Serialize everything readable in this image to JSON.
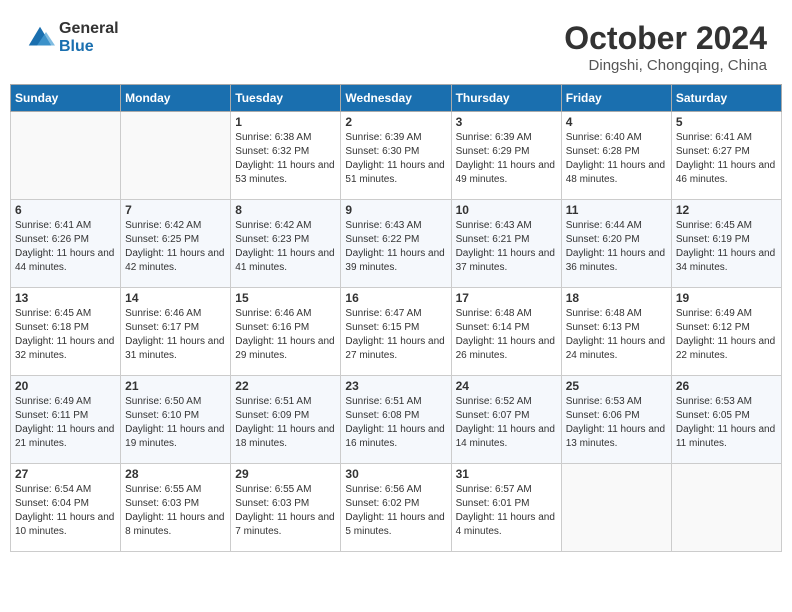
{
  "header": {
    "logo": {
      "general": "General",
      "blue": "Blue"
    },
    "title": "October 2024",
    "location": "Dingshi, Chongqing, China"
  },
  "weekdays": [
    "Sunday",
    "Monday",
    "Tuesday",
    "Wednesday",
    "Thursday",
    "Friday",
    "Saturday"
  ],
  "weeks": [
    [
      {
        "day": "",
        "info": ""
      },
      {
        "day": "",
        "info": ""
      },
      {
        "day": "1",
        "info": "Sunrise: 6:38 AM\nSunset: 6:32 PM\nDaylight: 11 hours and 53 minutes."
      },
      {
        "day": "2",
        "info": "Sunrise: 6:39 AM\nSunset: 6:30 PM\nDaylight: 11 hours and 51 minutes."
      },
      {
        "day": "3",
        "info": "Sunrise: 6:39 AM\nSunset: 6:29 PM\nDaylight: 11 hours and 49 minutes."
      },
      {
        "day": "4",
        "info": "Sunrise: 6:40 AM\nSunset: 6:28 PM\nDaylight: 11 hours and 48 minutes."
      },
      {
        "day": "5",
        "info": "Sunrise: 6:41 AM\nSunset: 6:27 PM\nDaylight: 11 hours and 46 minutes."
      }
    ],
    [
      {
        "day": "6",
        "info": "Sunrise: 6:41 AM\nSunset: 6:26 PM\nDaylight: 11 hours and 44 minutes."
      },
      {
        "day": "7",
        "info": "Sunrise: 6:42 AM\nSunset: 6:25 PM\nDaylight: 11 hours and 42 minutes."
      },
      {
        "day": "8",
        "info": "Sunrise: 6:42 AM\nSunset: 6:23 PM\nDaylight: 11 hours and 41 minutes."
      },
      {
        "day": "9",
        "info": "Sunrise: 6:43 AM\nSunset: 6:22 PM\nDaylight: 11 hours and 39 minutes."
      },
      {
        "day": "10",
        "info": "Sunrise: 6:43 AM\nSunset: 6:21 PM\nDaylight: 11 hours and 37 minutes."
      },
      {
        "day": "11",
        "info": "Sunrise: 6:44 AM\nSunset: 6:20 PM\nDaylight: 11 hours and 36 minutes."
      },
      {
        "day": "12",
        "info": "Sunrise: 6:45 AM\nSunset: 6:19 PM\nDaylight: 11 hours and 34 minutes."
      }
    ],
    [
      {
        "day": "13",
        "info": "Sunrise: 6:45 AM\nSunset: 6:18 PM\nDaylight: 11 hours and 32 minutes."
      },
      {
        "day": "14",
        "info": "Sunrise: 6:46 AM\nSunset: 6:17 PM\nDaylight: 11 hours and 31 minutes."
      },
      {
        "day": "15",
        "info": "Sunrise: 6:46 AM\nSunset: 6:16 PM\nDaylight: 11 hours and 29 minutes."
      },
      {
        "day": "16",
        "info": "Sunrise: 6:47 AM\nSunset: 6:15 PM\nDaylight: 11 hours and 27 minutes."
      },
      {
        "day": "17",
        "info": "Sunrise: 6:48 AM\nSunset: 6:14 PM\nDaylight: 11 hours and 26 minutes."
      },
      {
        "day": "18",
        "info": "Sunrise: 6:48 AM\nSunset: 6:13 PM\nDaylight: 11 hours and 24 minutes."
      },
      {
        "day": "19",
        "info": "Sunrise: 6:49 AM\nSunset: 6:12 PM\nDaylight: 11 hours and 22 minutes."
      }
    ],
    [
      {
        "day": "20",
        "info": "Sunrise: 6:49 AM\nSunset: 6:11 PM\nDaylight: 11 hours and 21 minutes."
      },
      {
        "day": "21",
        "info": "Sunrise: 6:50 AM\nSunset: 6:10 PM\nDaylight: 11 hours and 19 minutes."
      },
      {
        "day": "22",
        "info": "Sunrise: 6:51 AM\nSunset: 6:09 PM\nDaylight: 11 hours and 18 minutes."
      },
      {
        "day": "23",
        "info": "Sunrise: 6:51 AM\nSunset: 6:08 PM\nDaylight: 11 hours and 16 minutes."
      },
      {
        "day": "24",
        "info": "Sunrise: 6:52 AM\nSunset: 6:07 PM\nDaylight: 11 hours and 14 minutes."
      },
      {
        "day": "25",
        "info": "Sunrise: 6:53 AM\nSunset: 6:06 PM\nDaylight: 11 hours and 13 minutes."
      },
      {
        "day": "26",
        "info": "Sunrise: 6:53 AM\nSunset: 6:05 PM\nDaylight: 11 hours and 11 minutes."
      }
    ],
    [
      {
        "day": "27",
        "info": "Sunrise: 6:54 AM\nSunset: 6:04 PM\nDaylight: 11 hours and 10 minutes."
      },
      {
        "day": "28",
        "info": "Sunrise: 6:55 AM\nSunset: 6:03 PM\nDaylight: 11 hours and 8 minutes."
      },
      {
        "day": "29",
        "info": "Sunrise: 6:55 AM\nSunset: 6:03 PM\nDaylight: 11 hours and 7 minutes."
      },
      {
        "day": "30",
        "info": "Sunrise: 6:56 AM\nSunset: 6:02 PM\nDaylight: 11 hours and 5 minutes."
      },
      {
        "day": "31",
        "info": "Sunrise: 6:57 AM\nSunset: 6:01 PM\nDaylight: 11 hours and 4 minutes."
      },
      {
        "day": "",
        "info": ""
      },
      {
        "day": "",
        "info": ""
      }
    ]
  ]
}
